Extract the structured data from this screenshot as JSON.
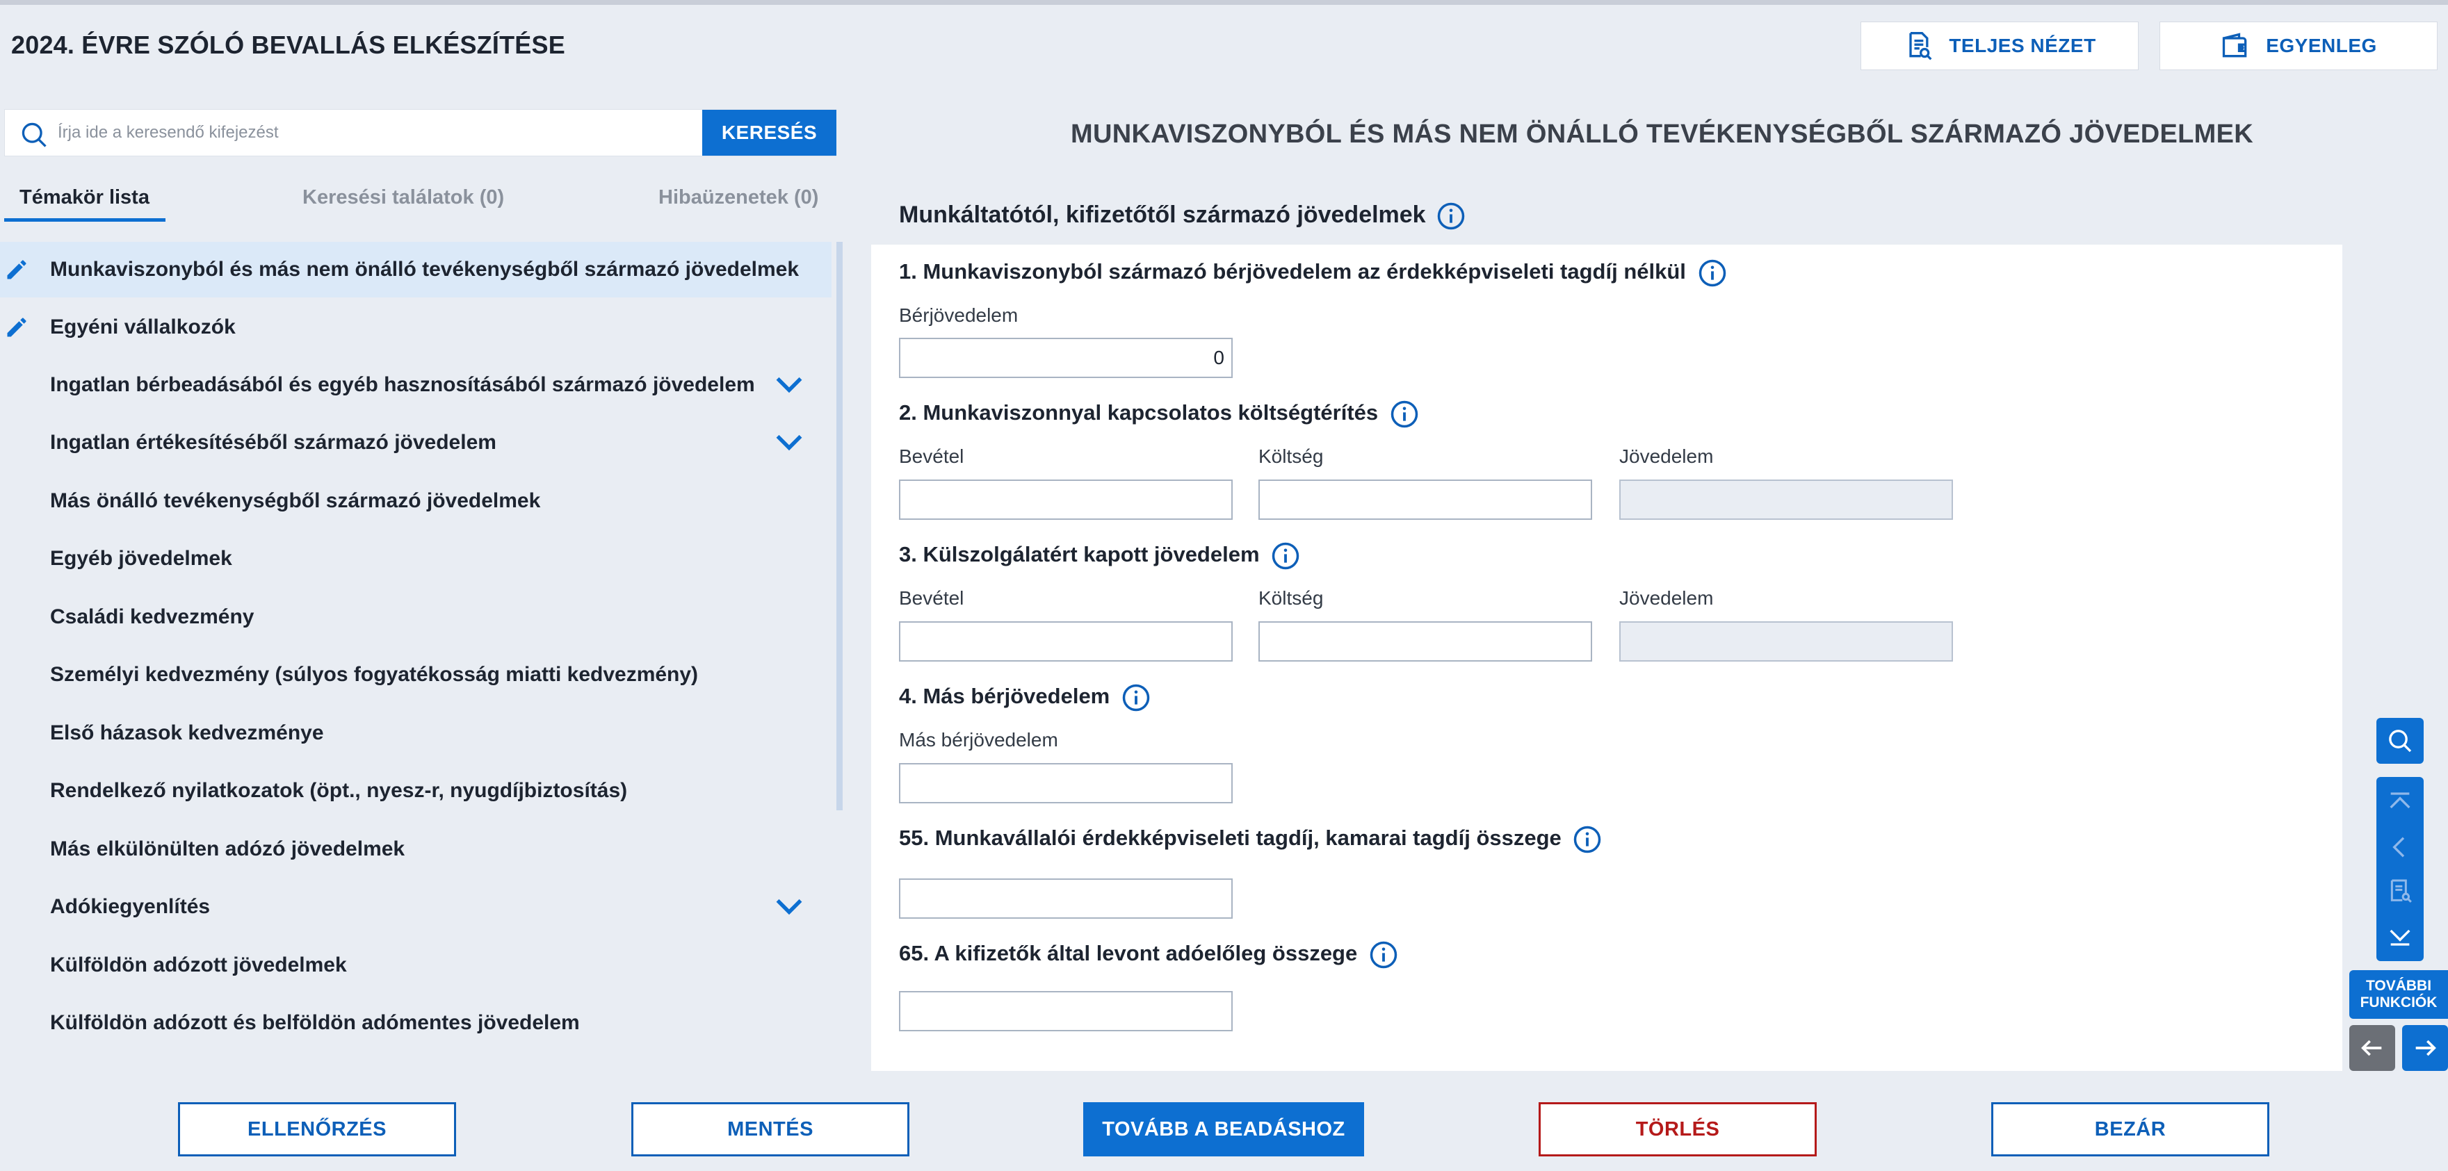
{
  "header": {
    "title": "2024. ÉVRE SZÓLÓ BEVALLÁS ELKÉSZÍTÉSE",
    "full_view_label": "TELJES NÉZET",
    "balance_label": "EGYENLEG"
  },
  "search": {
    "placeholder": "Írja ide a keresendő kifejezést",
    "button_label": "KERESÉS"
  },
  "tabs": [
    {
      "label": "Témakör lista",
      "active": true
    },
    {
      "label": "Keresési találatok (0)",
      "active": false
    },
    {
      "label": "Hibaüzenetek (0)",
      "active": false
    }
  ],
  "topics": [
    {
      "label": "Munkaviszonyból és más nem önálló tevékenységből származó jövedelmek",
      "edited": true,
      "selected": true,
      "expandable": false
    },
    {
      "label": "Egyéni vállalkozók",
      "edited": true,
      "selected": false,
      "expandable": false
    },
    {
      "label": "Ingatlan bérbeadásából és egyéb hasznosításából származó jövedelem",
      "edited": false,
      "selected": false,
      "expandable": true
    },
    {
      "label": "Ingatlan értékesítéséből származó jövedelem",
      "edited": false,
      "selected": false,
      "expandable": true
    },
    {
      "label": "Más önálló tevékenységből származó jövedelmek",
      "edited": false,
      "selected": false,
      "expandable": false
    },
    {
      "label": "Egyéb jövedelmek",
      "edited": false,
      "selected": false,
      "expandable": false
    },
    {
      "label": "Családi kedvezmény",
      "edited": false,
      "selected": false,
      "expandable": false
    },
    {
      "label": "Személyi kedvezmény (súlyos fogyatékosság miatti kedvezmény)",
      "edited": false,
      "selected": false,
      "expandable": false
    },
    {
      "label": "Első házasok kedvezménye",
      "edited": false,
      "selected": false,
      "expandable": false
    },
    {
      "label": "Rendelkező nyilatkozatok (öpt., nyesz-r, nyugdíjbiztosítás)",
      "edited": false,
      "selected": false,
      "expandable": false
    },
    {
      "label": "Más elkülönülten adózó jövedelmek",
      "edited": false,
      "selected": false,
      "expandable": false
    },
    {
      "label": "Adókiegyenlítés",
      "edited": false,
      "selected": false,
      "expandable": true
    },
    {
      "label": "Külföldön adózott jövedelmek",
      "edited": false,
      "selected": false,
      "expandable": false
    },
    {
      "label": "Külföldön adózott és belföldön adómentes jövedelem",
      "edited": false,
      "selected": false,
      "expandable": false
    }
  ],
  "main": {
    "section_title": "MUNKAVISZONYBÓL ÉS MÁS NEM ÖNÁLLÓ TEVÉKENYSÉGBŐL SZÁRMAZÓ JÖVEDELMEK",
    "card_title": "Munkáltatótól, kifizetőtől származó jövedelmek",
    "q1": {
      "title": "1. Munkaviszonyból származó bérjövedelem az érdekképviseleti tagdíj nélkül",
      "label": "Bérjövedelem",
      "value": "0"
    },
    "q2": {
      "title": "2. Munkaviszonnyal kapcsolatos költségtérítés",
      "revenue": "Bevétel",
      "cost": "Költség",
      "income": "Jövedelem"
    },
    "q3": {
      "title": "3. Külszolgálatért kapott jövedelem",
      "revenue": "Bevétel",
      "cost": "Költség",
      "income": "Jövedelem"
    },
    "q4": {
      "title": "4. Más bérjövedelem",
      "label": "Más bérjövedelem"
    },
    "q55": {
      "title": "55. Munkavállalói érdekképviseleti tagdíj, kamarai tagdíj összege"
    },
    "q65": {
      "title": "65. A kifizetők által levont adóelőleg összege"
    }
  },
  "right_toolbar": {
    "more_functions": [
      "TOVÁBBI",
      "FUNKCIÓK"
    ]
  },
  "footer": {
    "check": "ELLENŐRZÉS",
    "save": "MENTÉS",
    "submit": "TOVÁBB A BEADÁSHOZ",
    "delete": "TÖRLÉS",
    "close": "BEZÁR"
  },
  "colors": {
    "accent": "#0d6fd1",
    "danger": "#b51a1a",
    "selected_bg": "#dbe9f8",
    "page_bg": "#e9edf3"
  }
}
